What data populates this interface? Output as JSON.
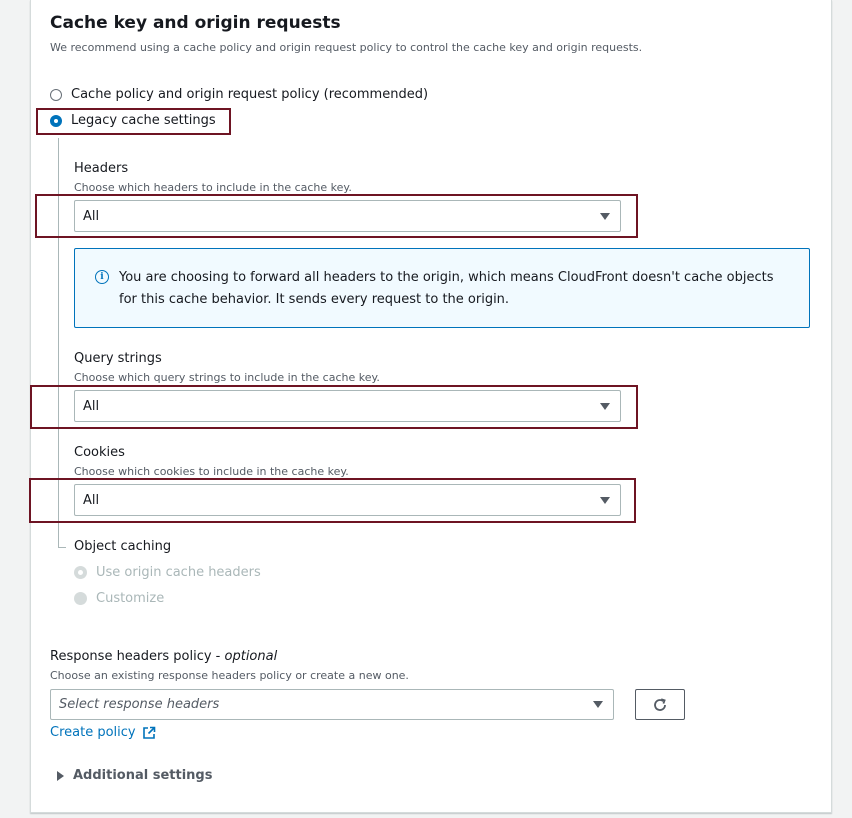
{
  "section": {
    "title": "Cache key and origin requests",
    "description": "We recommend using a cache policy and origin request policy to control the cache key and origin requests."
  },
  "options": {
    "cache_policy_label": "Cache policy and origin request policy (recommended)",
    "legacy_label": "Legacy cache settings",
    "selected": "Legacy cache settings"
  },
  "headers": {
    "label": "Headers",
    "description": "Choose which headers to include in the cache key.",
    "value": "All",
    "info": "You are choosing to forward all headers to the origin, which means CloudFront doesn't cache objects for this cache behavior. It sends every request to the origin."
  },
  "query_strings": {
    "label": "Query strings",
    "description": "Choose which query strings to include in the cache key.",
    "value": "All"
  },
  "cookies": {
    "label": "Cookies",
    "description": "Choose which cookies to include in the cache key.",
    "value": "All"
  },
  "object_caching": {
    "label": "Object caching",
    "use_origin_label": "Use origin cache headers",
    "customize_label": "Customize"
  },
  "response_headers": {
    "label": "Response headers policy",
    "optional": "optional",
    "separator": " - ",
    "description": "Choose an existing response headers policy or create a new one.",
    "placeholder": "Select response headers",
    "create_link": "Create policy"
  },
  "additional_settings": {
    "label": "Additional settings"
  },
  "colors": {
    "accent": "#0073bb",
    "highlight": "#6e1423",
    "info_bg": "#f1faff"
  }
}
